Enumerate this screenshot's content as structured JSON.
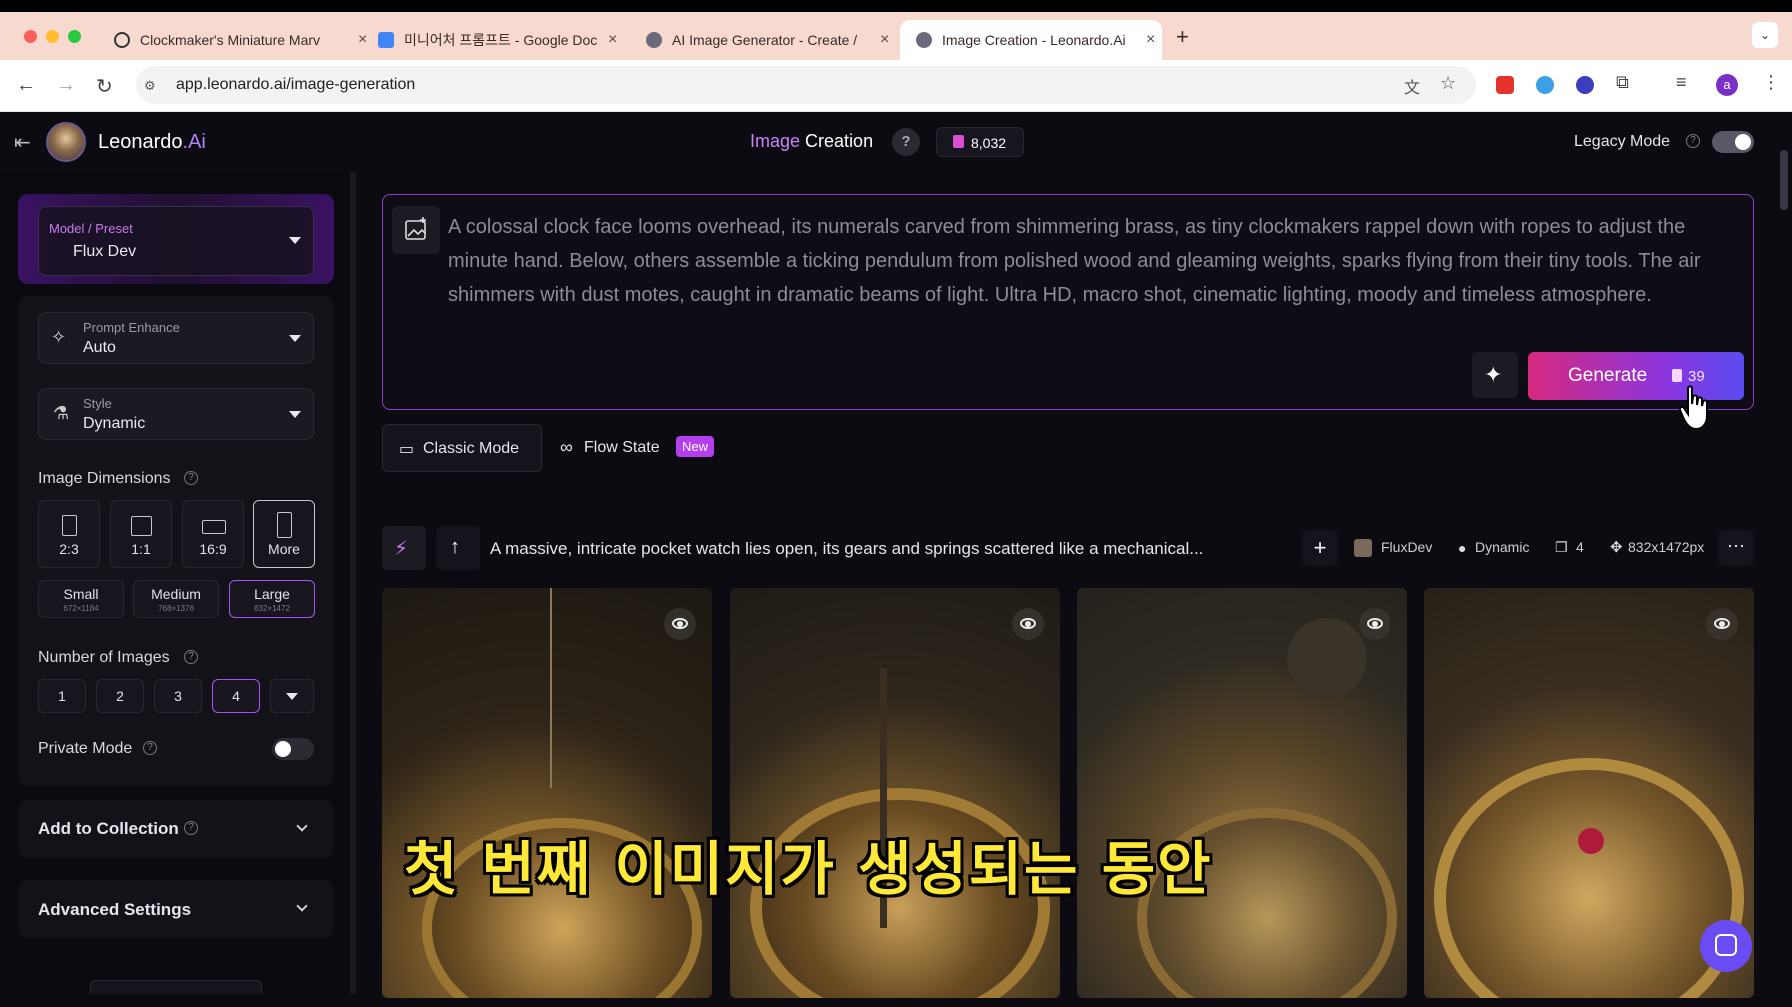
{
  "browser": {
    "tabs": [
      {
        "label": "Clockmaker's Miniature Marv",
        "active": false
      },
      {
        "label": "미니어처 프롬프트 - Google Doc",
        "active": false
      },
      {
        "label": "AI Image Generator - Create /",
        "active": false
      },
      {
        "label": "Image Creation - Leonardo.Ai",
        "active": true
      }
    ],
    "url": "app.leonardo.ai/image-generation",
    "profile_initial": "a"
  },
  "header": {
    "brand": "Leonardo",
    "brand_suffix": ".Ai",
    "title_part1": "Image",
    "title_part2": "Creation",
    "help": "?",
    "tokens": "8,032",
    "legacy_mode_label": "Legacy Mode"
  },
  "sidebar": {
    "model_label": "Model / Preset",
    "model_value": "Flux Dev",
    "prompt_enhance_label": "Prompt Enhance",
    "prompt_enhance_value": "Auto",
    "style_label": "Style",
    "style_value": "Dynamic",
    "image_dimensions_label": "Image Dimensions",
    "dimensions": [
      {
        "label": "2:3",
        "selected": false
      },
      {
        "label": "1:1",
        "selected": false
      },
      {
        "label": "16:9",
        "selected": false
      },
      {
        "label": "More",
        "selected": true
      }
    ],
    "sizes": [
      {
        "label": "Small",
        "dims": "672×1184",
        "selected": false
      },
      {
        "label": "Medium",
        "dims": "768×1376",
        "selected": false
      },
      {
        "label": "Large",
        "dims": "832×1472",
        "selected": true
      }
    ],
    "number_of_images_label": "Number of Images",
    "numbers": [
      "1",
      "2",
      "3",
      "4"
    ],
    "selected_number": "4",
    "private_mode_label": "Private Mode",
    "add_to_collection_label": "Add to Collection",
    "advanced_settings_label": "Advanced Settings"
  },
  "prompt": {
    "text": "A colossal clock face looms overhead, its numerals carved from shimmering brass, as tiny clockmakers rappel down with ropes to adjust the minute hand. Below, others assemble a ticking pendulum from polished wood and gleaming weights, sparks flying from their tiny tools. The air shimmers with dust motes, caught in dramatic beams of light. Ultra HD, macro shot, cinematic lighting, moody and timeless atmosphere.",
    "generate_label": "Generate",
    "generate_cost": "39"
  },
  "modes": {
    "classic": "Classic Mode",
    "flow": "Flow State",
    "new_badge": "New"
  },
  "generation": {
    "prompt": "A massive, intricate pocket watch lies open, its gears and springs scattered like a mechanical...",
    "model": "FluxDev",
    "style": "Dynamic",
    "count": "4",
    "size": "832x1472px"
  },
  "subtitle": "첫 번째 이미지가 생성되는 동안",
  "colors": {
    "accent_purple": "#a855f7",
    "generate_start": "#d6297f",
    "generate_end": "#5b4cf0",
    "subtitle_yellow": "#ffe838"
  }
}
